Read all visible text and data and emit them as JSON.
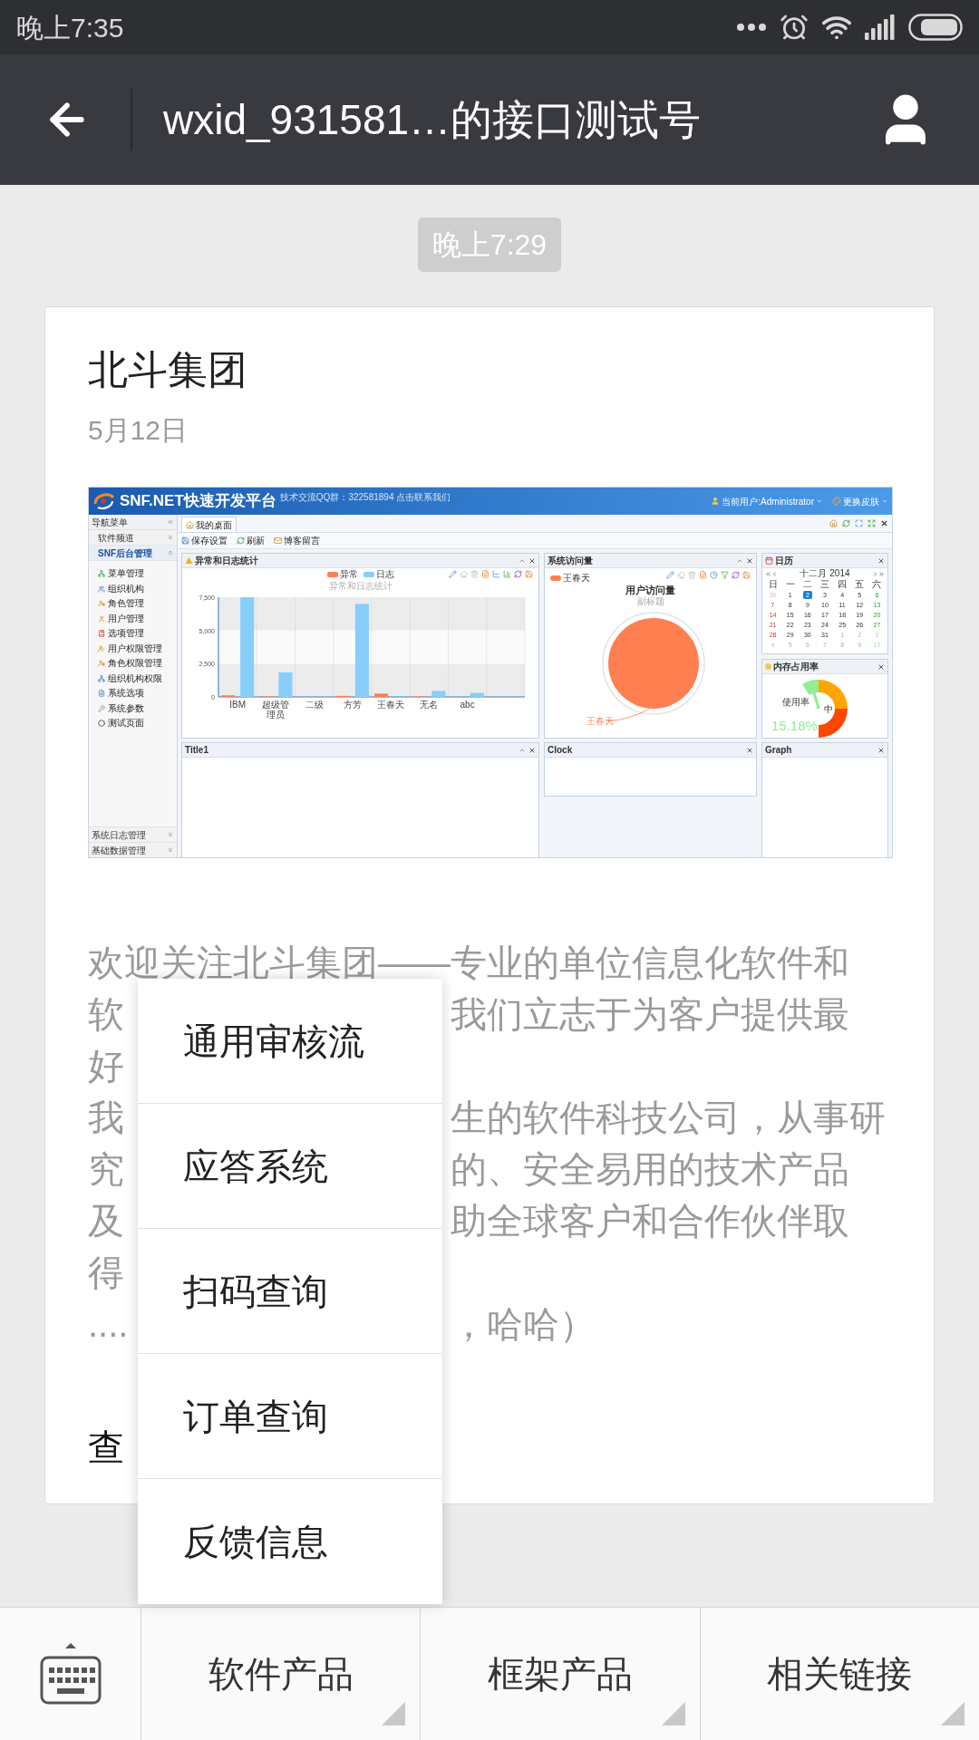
{
  "status_bar": {
    "time": "晚上7:35"
  },
  "nav": {
    "title": "wxid_931581…的接口测试号"
  },
  "chat": {
    "timestamp": "晚上7:29"
  },
  "article": {
    "title": "北斗集团",
    "date": "5月12日",
    "screenshot": {
      "app_title": "SNF.NET快速开发平台",
      "qq_note": "技术交流QQ群：322581894 点击联系我们",
      "user": "当前用户:Administrator",
      "skin": "更换皮肤",
      "sidebar": {
        "title": "导航菜单",
        "sections": [
          {
            "label": "软件频道",
            "expanded": false
          },
          {
            "label": "SNF后台管理",
            "expanded": true,
            "items": [
              "菜单管理",
              "组织机构",
              "角色管理",
              "用户管理",
              "选项管理",
              "用户权限管理",
              "角色权限管理",
              "组织机构权限",
              "系统选项",
              "系统参数",
              "测试页面"
            ]
          }
        ],
        "footer_sections": [
          "系统日志管理",
          "基础数据管理"
        ]
      },
      "tabs": [
        {
          "label": "我的桌面",
          "selected": true
        }
      ],
      "toolbar": [
        "保存设置",
        "刷新",
        "博客留言"
      ],
      "log_panel": {
        "title": "异常和日志统计",
        "chart_data": {
          "type": "bar",
          "title": "异常和日志统计",
          "categories": [
            "IBM",
            "超级管理员",
            "二级",
            "方芳",
            "王春天",
            "无名",
            "abc"
          ],
          "series": [
            {
              "name": "异常",
              "color": "#ff7f50",
              "values": [
                120,
                40,
                null,
                80,
                250,
                40,
                0
              ]
            },
            {
              "name": "日志",
              "color": "#87cefa",
              "values": [
                7500,
                1850,
                0,
                7000,
                null,
                450,
                300
              ]
            }
          ],
          "legend": true,
          "ylim": [
            0,
            7500
          ],
          "yticks": [
            {
              "value": 0,
              "label": "0"
            },
            {
              "value": 2500,
              "label": "2,500"
            },
            {
              "value": 5000,
              "label": "5,000"
            },
            {
              "value": 7500,
              "label": "7,500"
            }
          ]
        }
      },
      "visits_panel": {
        "title": "系统访问量",
        "legend": "王春天",
        "chart_title": "用户访问量",
        "subtitle": "副标题",
        "slice_label": "王春天"
      },
      "calendar": {
        "title": "日历",
        "month": "十二月 2014",
        "weekdays": [
          "日",
          "一",
          "二",
          "三",
          "四",
          "五",
          "六"
        ],
        "weeks": [
          [
            {
              "d": "30",
              "out": true,
              "selected": false
            },
            {
              "d": "1",
              "out": false,
              "selected": false
            },
            {
              "d": "2",
              "out": false,
              "selected": true
            },
            {
              "d": "3",
              "out": false,
              "selected": false
            },
            {
              "d": "4",
              "out": false,
              "selected": false
            },
            {
              "d": "5",
              "out": false,
              "selected": false
            },
            {
              "d": "6",
              "out": false,
              "selected": false
            }
          ],
          [
            {
              "d": "7",
              "out": false,
              "selected": false
            },
            {
              "d": "8",
              "out": false,
              "selected": false
            },
            {
              "d": "9",
              "out": false,
              "selected": false
            },
            {
              "d": "10",
              "out": false,
              "selected": false
            },
            {
              "d": "11",
              "out": false,
              "selected": false
            },
            {
              "d": "12",
              "out": false,
              "selected": false
            },
            {
              "d": "13",
              "out": false,
              "selected": false
            }
          ],
          [
            {
              "d": "14",
              "out": false,
              "selected": false
            },
            {
              "d": "15",
              "out": false,
              "selected": false
            },
            {
              "d": "16",
              "out": false,
              "selected": false
            },
            {
              "d": "17",
              "out": false,
              "selected": false
            },
            {
              "d": "18",
              "out": false,
              "selected": false
            },
            {
              "d": "19",
              "out": false,
              "selected": false
            },
            {
              "d": "20",
              "out": false,
              "selected": false
            }
          ],
          [
            {
              "d": "21",
              "out": false,
              "selected": false
            },
            {
              "d": "22",
              "out": false,
              "selected": false
            },
            {
              "d": "23",
              "out": false,
              "selected": false
            },
            {
              "d": "24",
              "out": false,
              "selected": false
            },
            {
              "d": "25",
              "out": false,
              "selected": false
            },
            {
              "d": "26",
              "out": false,
              "selected": false
            },
            {
              "d": "27",
              "out": false,
              "selected": false
            }
          ],
          [
            {
              "d": "28",
              "out": false,
              "selected": false
            },
            {
              "d": "29",
              "out": false,
              "selected": false
            },
            {
              "d": "30",
              "out": false,
              "selected": false
            },
            {
              "d": "31",
              "out": false,
              "selected": false
            },
            {
              "d": "1",
              "out": true,
              "selected": false
            },
            {
              "d": "2",
              "out": true,
              "selected": false
            },
            {
              "d": "3",
              "out": true,
              "selected": false
            }
          ],
          [
            {
              "d": "4",
              "out": true,
              "selected": false
            },
            {
              "d": "5",
              "out": true,
              "selected": false
            },
            {
              "d": "6",
              "out": true,
              "selected": false
            },
            {
              "d": "7",
              "out": true,
              "selected": false
            },
            {
              "d": "8",
              "out": true,
              "selected": false
            },
            {
              "d": "9",
              "out": true,
              "selected": false
            },
            {
              "d": "10",
              "out": true,
              "selected": false
            }
          ]
        ]
      },
      "memory_panel": {
        "title": "内存占用率",
        "label": "使用率",
        "reading": "15.18%",
        "mark_label": "中"
      },
      "bottom_panels": [
        "Title1",
        "Clock",
        "Graph"
      ]
    },
    "excerpt": [
      {
        "left": "欢迎关注北斗集团——专业的单位信息化软件和"
      },
      {
        "left": "软",
        "right": "我们立志于为客户提供最"
      },
      {
        "left": "好"
      },
      {
        "left": "我",
        "right": "生的软件科技公司，从事研"
      },
      {
        "left": "究",
        "right": "的、安全易用的技术产品"
      },
      {
        "left": "及",
        "right": "助全球客户和合作伙伴取"
      },
      {
        "left": "得"
      },
      {
        "left": "....",
        "right": "，哈哈）"
      }
    ],
    "read_more": "查"
  },
  "popup_menu": {
    "items": [
      "通用审核流",
      "应答系统",
      "扫码查询",
      "订单查询",
      "反馈信息"
    ]
  },
  "bottom_menu": {
    "items": [
      {
        "label": "软件产品",
        "has_submenu": true
      },
      {
        "label": "框架产品",
        "has_submenu": true
      },
      {
        "label": "相关链接",
        "has_submenu": true
      }
    ]
  }
}
